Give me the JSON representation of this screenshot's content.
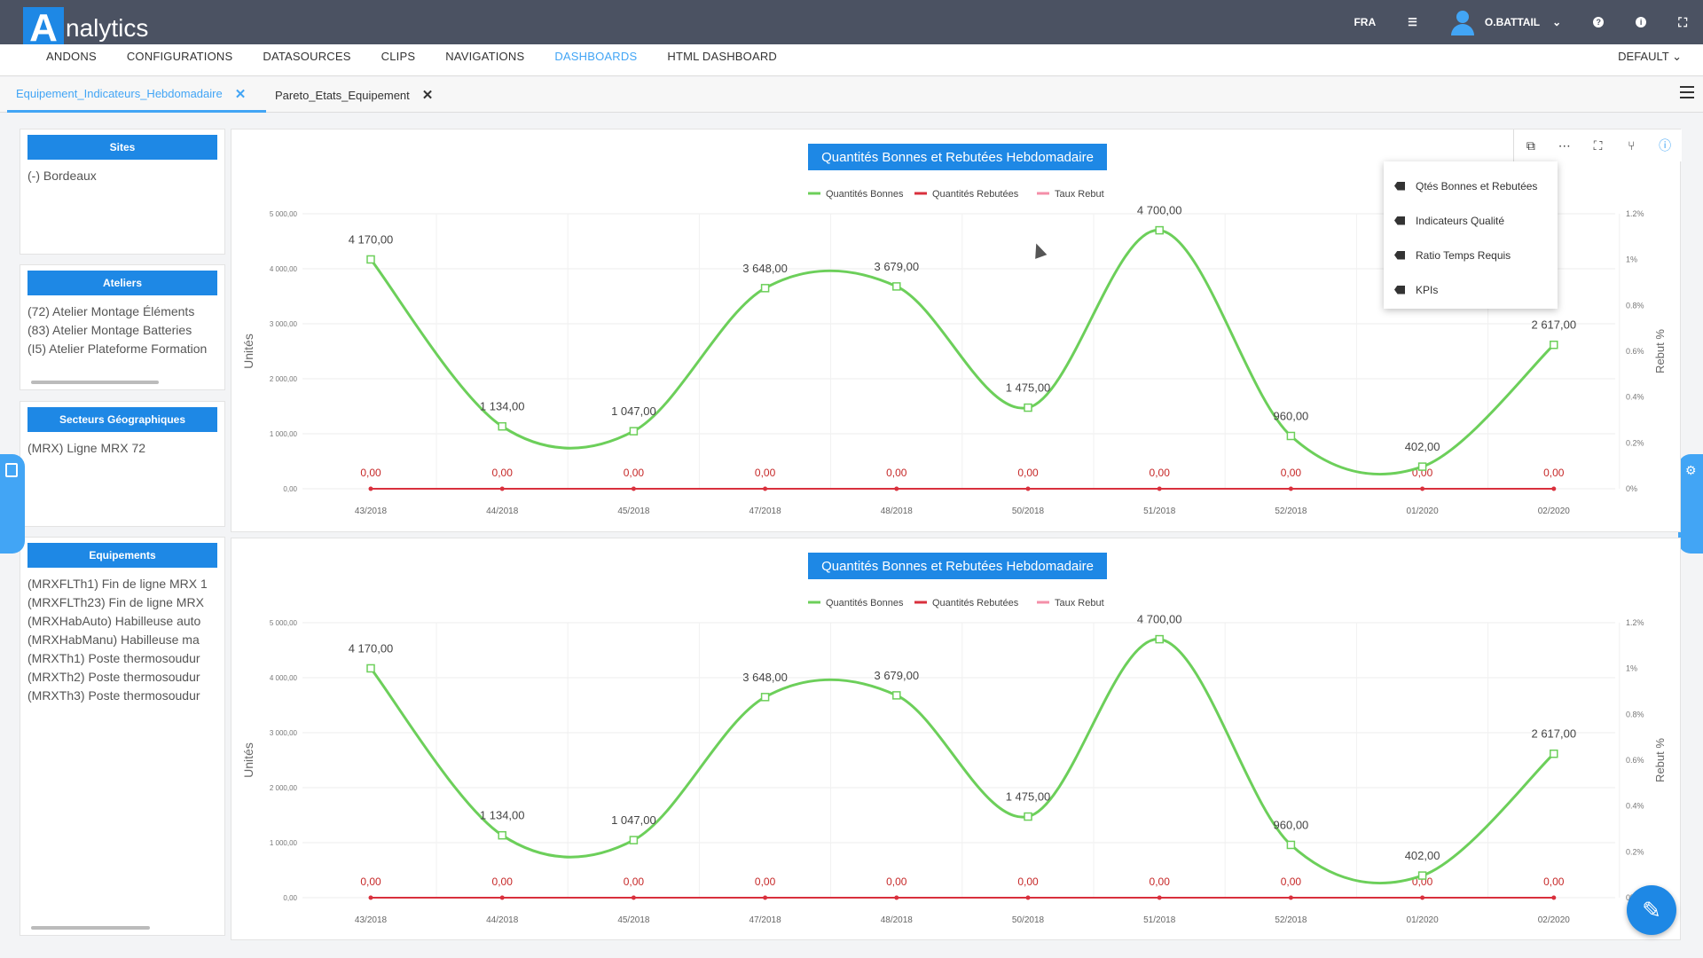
{
  "app": {
    "logo_letter": "A",
    "logo_rest": "nalytics"
  },
  "topbar": {
    "lang": "FRA",
    "user": "O.BATTAIL",
    "menu_icon": "list-icon",
    "info_icon": "info-icon",
    "help_icon": "help-icon",
    "expand_icon": "expand-icon"
  },
  "menu": {
    "items": [
      "ANDONS",
      "CONFIGURATIONS",
      "DATASOURCES",
      "CLIPS",
      "NAVIGATIONS",
      "DASHBOARDS",
      "HTML DASHBOARD"
    ],
    "active": "DASHBOARDS",
    "default_label": "DEFAULT"
  },
  "tabs": [
    {
      "label": "Equipement_Indicateurs_Hebdomadaire",
      "active": true
    },
    {
      "label": "Pareto_Etats_Equipement",
      "active": false
    }
  ],
  "filters": {
    "sites": {
      "title": "Sites",
      "items": [
        "(-) Bordeaux"
      ]
    },
    "ateliers": {
      "title": "Ateliers",
      "items": [
        "(72) Atelier Montage Éléments",
        "(83) Atelier Montage Batteries",
        "(I5) Atelier Plateforme Formation"
      ]
    },
    "secteurs": {
      "title": "Secteurs Géographiques",
      "items": [
        "(MRX) Ligne MRX 72"
      ]
    },
    "equipements": {
      "title": "Equipements",
      "items": [
        "(MRXFLTh1) Fin de ligne MRX 1",
        "(MRXFLTh23) Fin de ligne MRX",
        "(MRXHabAuto) Habilleuse auto",
        "(MRXHabManu) Habilleuse ma",
        "(MRXTh1) Poste thermosoudur",
        "(MRXTh2) Poste thermosoudur",
        "(MRXTh3) Poste thermosoudur"
      ]
    }
  },
  "toolbar": {
    "icons": [
      "copy-icon",
      "more-icon",
      "fullscreen-icon",
      "filter-icon",
      "info-icon"
    ]
  },
  "dropdown": {
    "items": [
      "Qtés Bonnes et Rebutées",
      "Indicateurs Qualité",
      "Ratio Temps Requis",
      "KPIs"
    ]
  },
  "colors": {
    "accent": "#1e88e5",
    "good": "#6ccf5a",
    "scrap": "#d9303d",
    "rate": "#f48fa8",
    "topbar": "#4b5262"
  },
  "chart_data": [
    {
      "type": "line",
      "title": "Quantités Bonnes et Rebutées Hebdomadaire",
      "categories": [
        "43/2018",
        "44/2018",
        "45/2018",
        "47/2018",
        "48/2018",
        "50/2018",
        "51/2018",
        "52/2018",
        "01/2020",
        "02/2020"
      ],
      "series": [
        {
          "name": "Quantités Bonnes",
          "values": [
            4170,
            1134,
            1047,
            3648,
            3679,
            1475,
            4700,
            960,
            402,
            2617
          ],
          "labels": [
            "4 170,00",
            "1 134,00",
            "1 047,00",
            "3 648,00",
            "3 679,00",
            "1 475,00",
            "4 700,00",
            "960,00",
            "402,00",
            "2 617,00"
          ]
        },
        {
          "name": "Quantités Rebutées",
          "values": [
            0,
            0,
            0,
            0,
            0,
            0,
            0,
            0,
            0,
            0
          ],
          "labels": [
            "0,00",
            "0,00",
            "0,00",
            "0,00",
            "0,00",
            "0,00",
            "0,00",
            "0,00",
            "0,00",
            "0,00"
          ]
        },
        {
          "name": "Taux Rebut",
          "values": [
            0,
            0,
            0,
            0,
            0,
            0,
            0,
            0,
            0,
            0
          ]
        }
      ],
      "ylabel": "Unités",
      "y2label": "Rebut %",
      "ylim": [
        0,
        5000
      ],
      "yticks": [
        "0,00",
        "1 000,00",
        "2 000,00",
        "3 000,00",
        "4 000,00",
        "5 000,00"
      ],
      "y2lim": [
        0,
        1.2
      ],
      "y2ticks": [
        "0%",
        "0.2%",
        "0.4%",
        "0.6%",
        "0.8%",
        "1%",
        "1.2%"
      ],
      "grid": true,
      "legend": "top-center"
    },
    {
      "type": "line",
      "title": "Quantités Bonnes et Rebutées Hebdomadaire",
      "categories": [
        "43/2018",
        "44/2018",
        "45/2018",
        "47/2018",
        "48/2018",
        "50/2018",
        "51/2018",
        "52/2018",
        "01/2020",
        "02/2020"
      ],
      "series": [
        {
          "name": "Quantités Bonnes",
          "values": [
            4170,
            1134,
            1047,
            3648,
            3679,
            1475,
            4700,
            960,
            402,
            2617
          ],
          "labels": [
            "4 170,00",
            "1 134,00",
            "1 047,00",
            "3 648,00",
            "3 679,00",
            "1 475,00",
            "4 700,00",
            "960,00",
            "402,00",
            "2 617,00"
          ]
        },
        {
          "name": "Quantités Rebutées",
          "values": [
            0,
            0,
            0,
            0,
            0,
            0,
            0,
            0,
            0,
            0
          ],
          "labels": [
            "0,00",
            "0,00",
            "0,00",
            "0,00",
            "0,00",
            "0,00",
            "0,00",
            "0,00",
            "0,00",
            "0,00"
          ]
        },
        {
          "name": "Taux Rebut",
          "values": [
            0,
            0,
            0,
            0,
            0,
            0,
            0,
            0,
            0,
            0
          ]
        }
      ],
      "ylabel": "Unités",
      "y2label": "Rebut %",
      "ylim": [
        0,
        5000
      ],
      "yticks": [
        "0,00",
        "1 000,00",
        "2 000,00",
        "3 000,00",
        "4 000,00",
        "5 000,00"
      ],
      "y2lim": [
        0,
        1.2
      ],
      "y2ticks": [
        "0%",
        "0.2%",
        "0.4%",
        "0.6%",
        "0.8%",
        "1%",
        "1.2%"
      ],
      "grid": true,
      "legend": "top-center"
    }
  ]
}
